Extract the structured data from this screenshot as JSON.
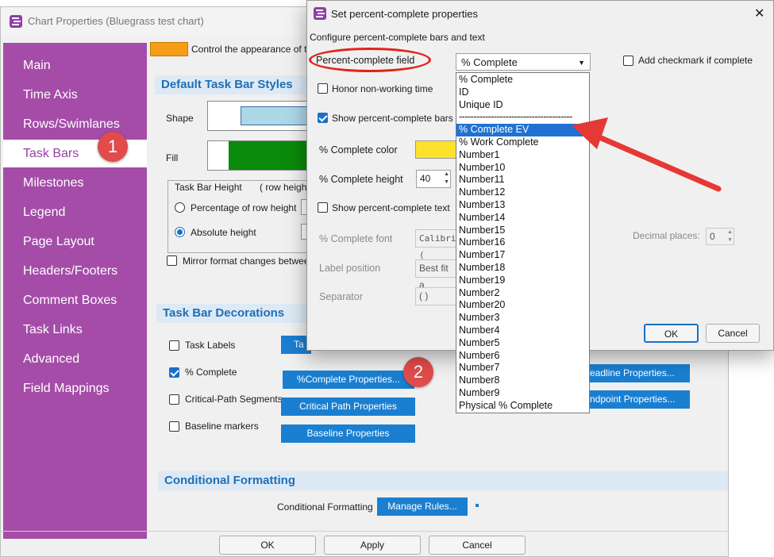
{
  "main_window": {
    "title": "Chart Properties (Bluegrass test chart)",
    "sidebar": [
      "Main",
      "Time Axis",
      "Rows/Swimlanes",
      "Task Bars",
      "Milestones",
      "Legend",
      "Page Layout",
      "Headers/Footers",
      "Comment Boxes",
      "Task Links",
      "Advanced",
      "Field Mappings"
    ],
    "active_item": "Task Bars",
    "step_badges": [
      "1",
      "2"
    ],
    "top_hint": "Control the appearance of ta",
    "default_styles": {
      "heading": "Default Task Bar Styles",
      "shape_label": "Shape",
      "fill_label": "Fill",
      "height_group_label": "Task Bar Height",
      "row_height_hint": "( row height",
      "percentage_label": "Percentage of row height",
      "absolute_label": "Absolute height",
      "mirror_label": "Mirror format changes between"
    },
    "decorations": {
      "heading": "Task Bar Decorations",
      "items": [
        {
          "label": "Task Labels",
          "checked": false,
          "button": "Ta"
        },
        {
          "label": "% Complete",
          "checked": true,
          "button": "%Complete Properties..."
        },
        {
          "label": "Critical-Path Segments",
          "checked": false,
          "button": "Critical Path Properties"
        },
        {
          "label": "Baseline markers",
          "checked": false,
          "button": "Baseline Properties"
        }
      ],
      "right_buttons": [
        "eadline Properties...",
        "ndpoint Properties..."
      ]
    },
    "conditional": {
      "heading": "Conditional Formatting",
      "label": "Conditional Formatting",
      "button": "Manage Rules..."
    },
    "footer_buttons": [
      "OK",
      "Apply",
      "Cancel"
    ],
    "colors": {
      "sidebar": "#a44ca8",
      "fill": "#0a8a0a",
      "shape": "#add8e6",
      "accent": "#1a7fd0"
    }
  },
  "dialog": {
    "title": "Set percent-complete properties",
    "subtitle": "Configure percent-complete bars and text",
    "field_label": "Percent-complete field",
    "field_value": "% Complete",
    "add_checkmark_label": "Add checkmark if complete",
    "honor_label": "Honor non-working time",
    "show_bars_label": "Show percent-complete bars",
    "color_label": "% Complete color",
    "height_label": "% Complete height",
    "height_value": "40",
    "show_text_label": "Show percent-complete text",
    "font_label": "% Complete font",
    "font_value": "Calibri (",
    "label_position_label": "Label position",
    "label_position_value": "Best fit a",
    "separator_label": "Separator",
    "separator_value": "( )",
    "decimal_label": "Decimal places:",
    "decimal_value": "0",
    "ok_label": "OK",
    "cancel_label": "Cancel",
    "close_glyph": "✕",
    "colors": {
      "complete_color": "#fde12d",
      "highlight": "#1f72d1",
      "annotation": "#e53935"
    }
  },
  "dropdown": {
    "options": [
      "% Complete",
      "ID",
      "Unique ID",
      "---------------------------------------",
      "% Complete EV",
      "% Work Complete",
      "Number1",
      "Number10",
      "Number11",
      "Number12",
      "Number13",
      "Number14",
      "Number15",
      "Number16",
      "Number17",
      "Number18",
      "Number19",
      "Number2",
      "Number20",
      "Number3",
      "Number4",
      "Number5",
      "Number6",
      "Number7",
      "Number8",
      "Number9",
      "Physical % Complete"
    ],
    "selected": "% Complete EV"
  }
}
